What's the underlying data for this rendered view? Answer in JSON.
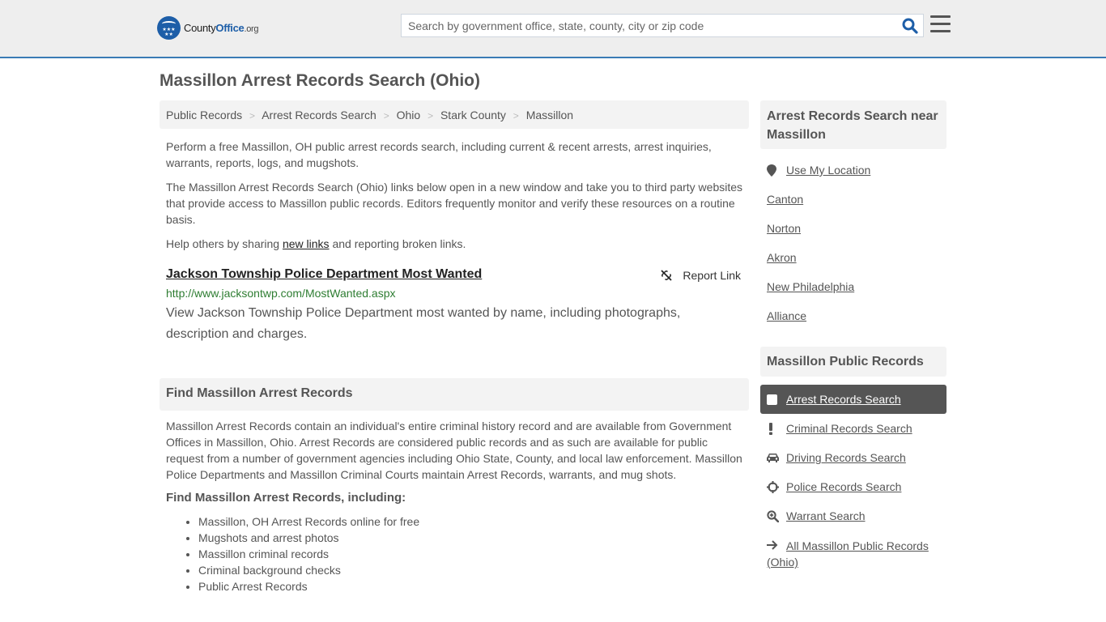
{
  "header": {
    "logo": {
      "name_part1": "County",
      "name_part2": "Office",
      "tld": ".org"
    },
    "search": {
      "placeholder": "Search by government office, state, county, city or zip code",
      "value": ""
    },
    "colors": {
      "brand": "#1d5ea8",
      "accent_line": "#3a7bb5"
    }
  },
  "page_title": "Massillon Arrest Records Search (Ohio)",
  "breadcrumb": [
    {
      "label": "Public Records"
    },
    {
      "label": "Arrest Records Search"
    },
    {
      "label": "Ohio"
    },
    {
      "label": "Stark County"
    },
    {
      "label": "Massillon"
    }
  ],
  "breadcrumb_separator": ">",
  "intro": {
    "p1": "Perform a free Massillon, OH public arrest records search, including current & recent arrests, arrest inquiries, warrants, reports, logs, and mugshots.",
    "p2": "The Massillon Arrest Records Search (Ohio) links below open in a new window and take you to third party websites that provide access to Massillon public records. Editors frequently monitor and verify these resources on a routine basis.",
    "p3_before": "Help others by sharing ",
    "p3_link": "new links",
    "p3_after": " and reporting broken links."
  },
  "results": [
    {
      "title": "Jackson Township Police Department Most Wanted",
      "url": "http://www.jacksontwp.com/MostWanted.aspx",
      "description": "View Jackson Township Police Department most wanted by name, including photographs, description and charges.",
      "report_label": "Report Link"
    }
  ],
  "find_section": {
    "heading": "Find Massillon Arrest Records",
    "body": "Massillon Arrest Records contain an individual's entire criminal history record and are available from Government Offices in Massillon, Ohio. Arrest Records are considered public records and as such are available for public request from a number of government agencies including Ohio State, County, and local law enforcement. Massillon Police Departments and Massillon Criminal Courts maintain Arrest Records, warrants, and mug shots.",
    "subheading": "Find Massillon Arrest Records, including:",
    "items": [
      "Massillon, OH Arrest Records online for free",
      "Mugshots and arrest photos",
      "Massillon criminal records",
      "Criminal background checks",
      "Public Arrest Records"
    ]
  },
  "sidebar_nearby": {
    "heading": "Arrest Records Search near Massillon",
    "use_location": "Use My Location",
    "cities": [
      "Canton",
      "Norton",
      "Akron",
      "New Philadelphia",
      "Alliance"
    ]
  },
  "sidebar_public_records": {
    "heading": "Massillon Public Records",
    "items": [
      {
        "label": "Arrest Records Search",
        "icon": "square-icon",
        "active": true
      },
      {
        "label": "Criminal Records Search",
        "icon": "exclamation-icon",
        "active": false
      },
      {
        "label": "Driving Records Search",
        "icon": "car-icon",
        "active": false
      },
      {
        "label": "Police Records Search",
        "icon": "crosshairs-icon",
        "active": false
      },
      {
        "label": "Warrant Search",
        "icon": "search-plus-icon",
        "active": false
      },
      {
        "label": "All Massillon Public Records (Ohio)",
        "icon": "arrow-right-icon",
        "active": false
      }
    ]
  }
}
